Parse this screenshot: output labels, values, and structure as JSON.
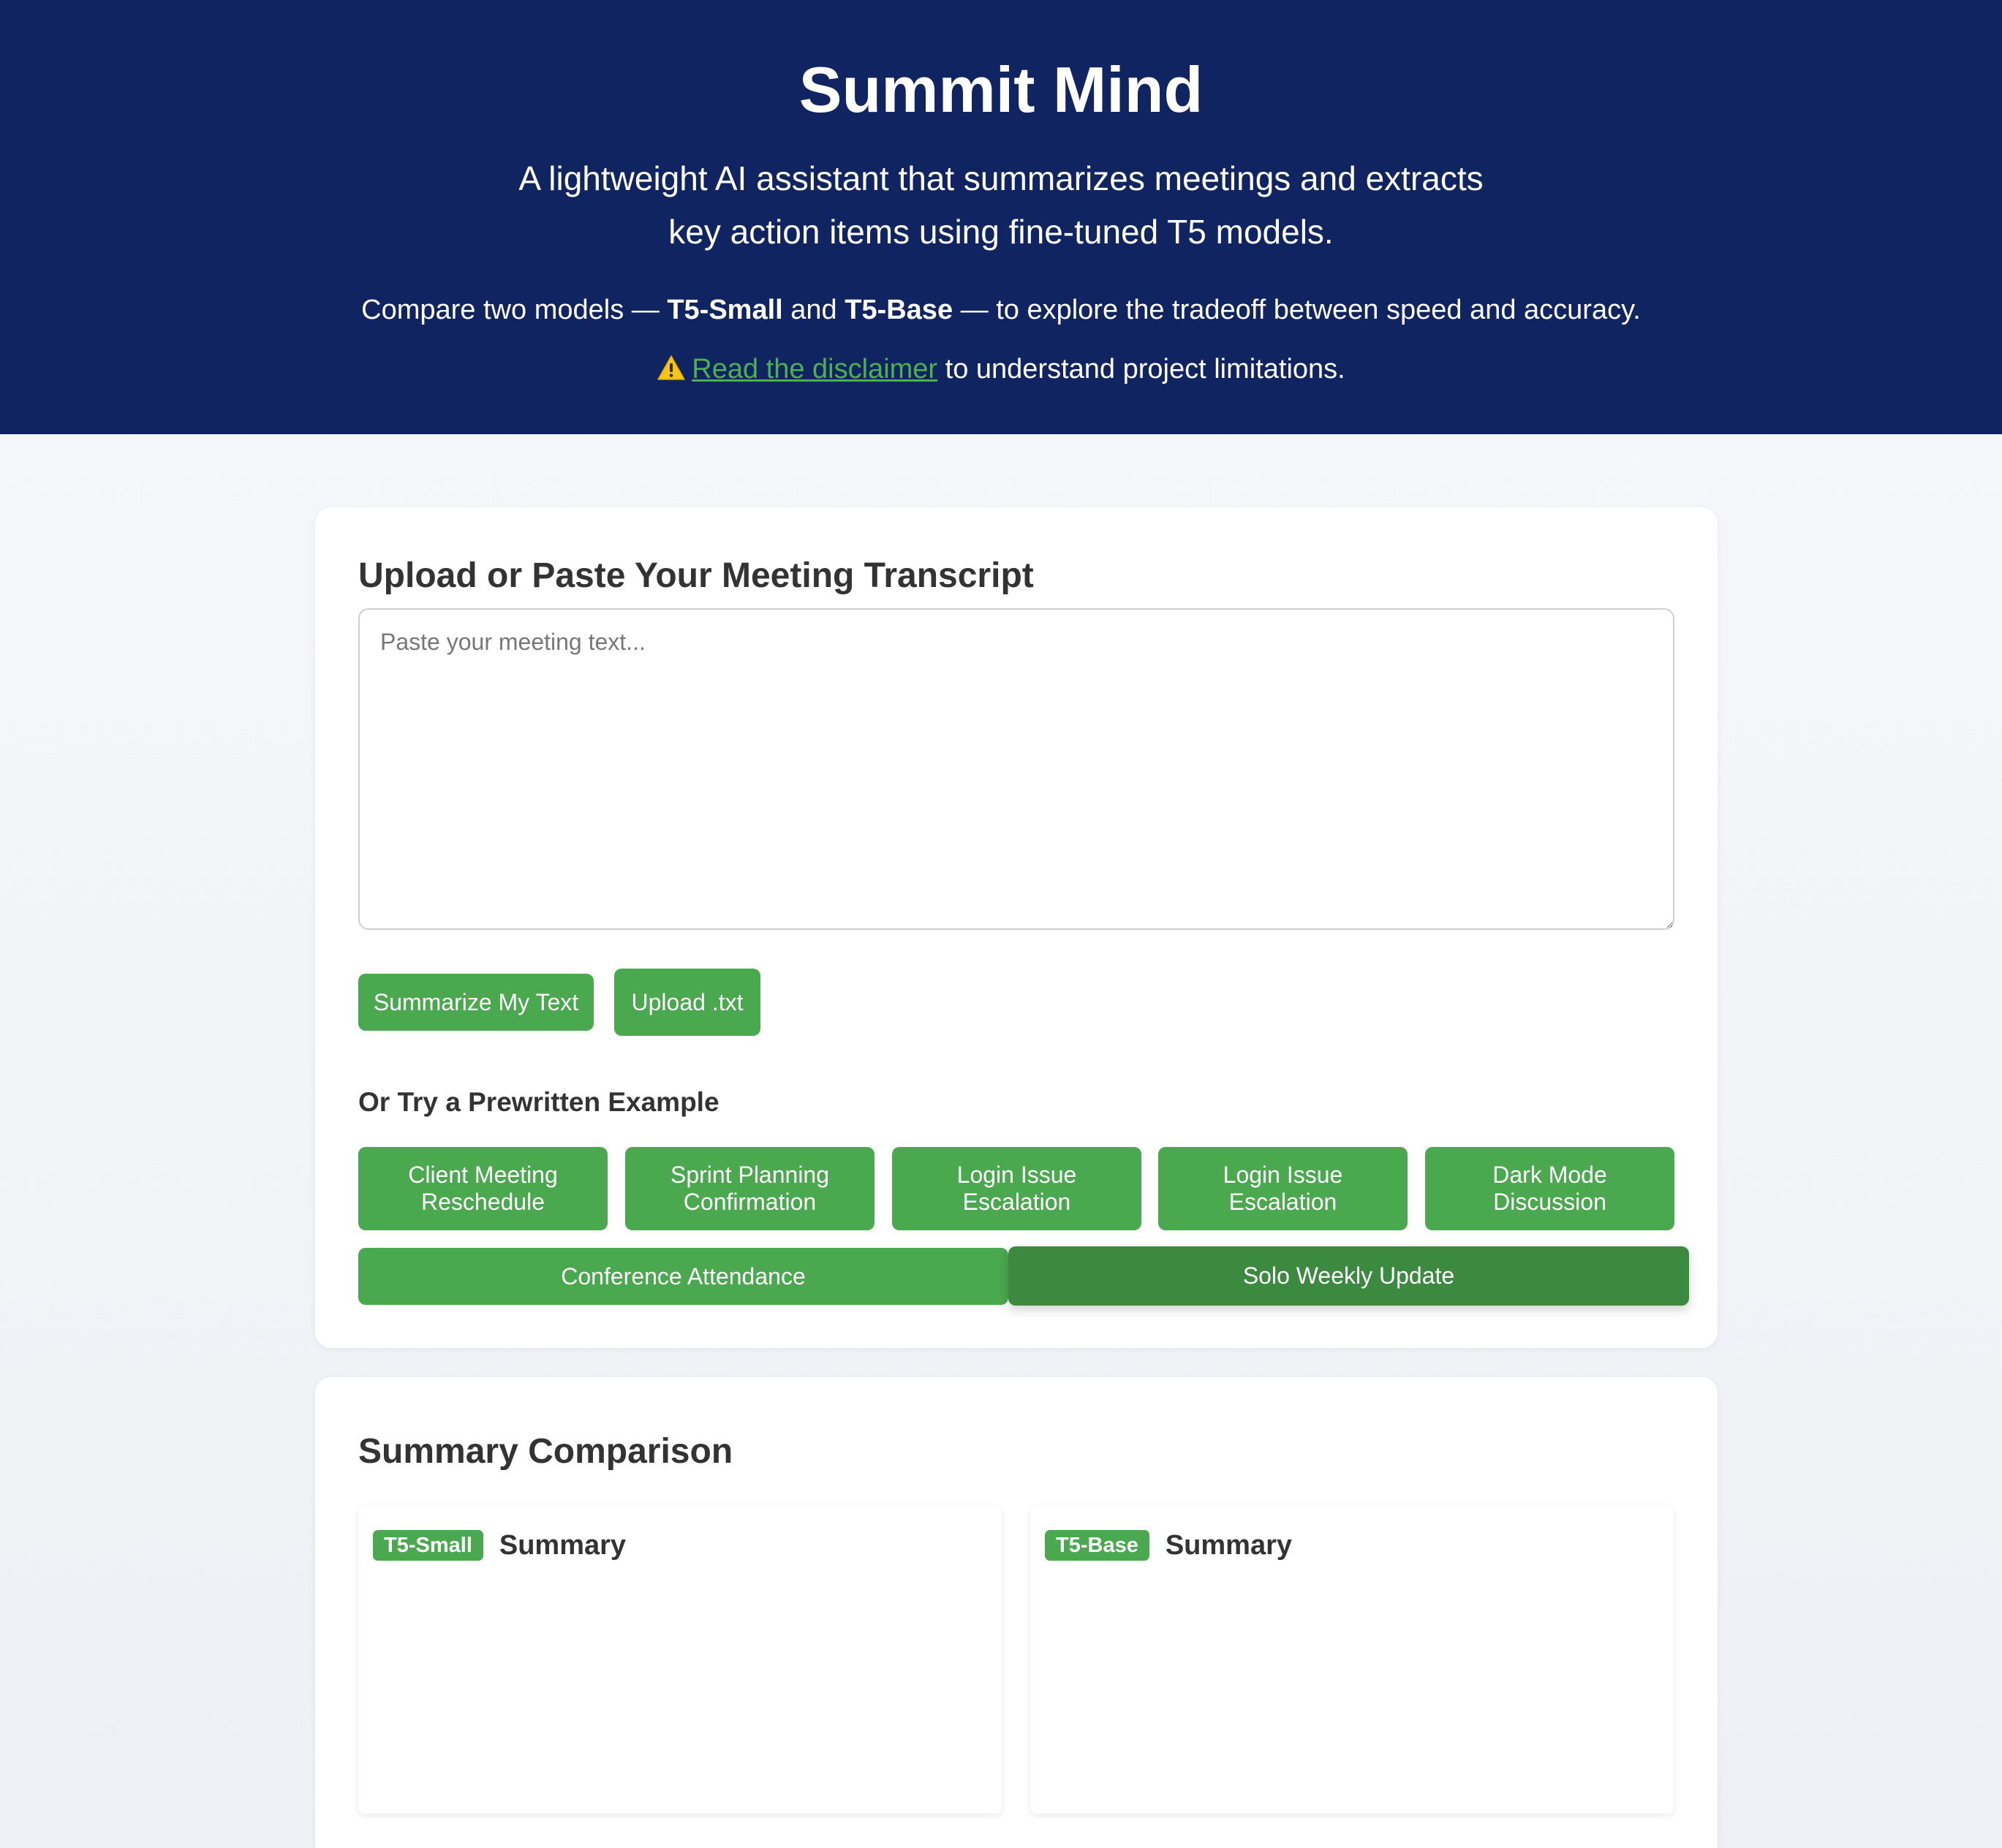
{
  "header": {
    "title": "Summit Mind",
    "description": "A lightweight AI assistant that summarizes meetings and extracts key action items using fine-tuned T5 models.",
    "compare": {
      "prefix": "Compare two models — ",
      "model_a": "T5-Small",
      "and": " and ",
      "model_b": "T5-Base",
      "suffix": " — to explore the tradeoff between speed and accuracy."
    },
    "disclaimer": {
      "icon": "warning-icon",
      "link_text": "Read the disclaimer",
      "suffix": " to understand project limitations."
    }
  },
  "upload": {
    "title": "Upload or Paste Your Meeting Transcript",
    "input_value": "",
    "input_placeholder": "Paste your meeting text...",
    "summarize_label": "Summarize My Text",
    "upload_label": "Upload .txt"
  },
  "examples": {
    "title": "Or Try a Prewritten Example",
    "items": [
      "Client Meeting Reschedule",
      "Sprint Planning Confirmation",
      "Login Issue Escalation",
      "Login Issue Escalation",
      "Dark Mode Discussion",
      "Conference Attendance",
      "Solo Weekly Update"
    ]
  },
  "summary": {
    "title": "Summary Comparison",
    "panels": [
      {
        "badge": "T5-Small",
        "label": "Summary",
        "content": ""
      },
      {
        "badge": "T5-Base",
        "label": "Summary",
        "content": ""
      }
    ]
  },
  "colors": {
    "header_bg": "#112462",
    "accent_green": "#4aa84f",
    "active_green": "#3c8a40",
    "link_green": "#4caf50",
    "warning_yellow": "#f5c518"
  }
}
